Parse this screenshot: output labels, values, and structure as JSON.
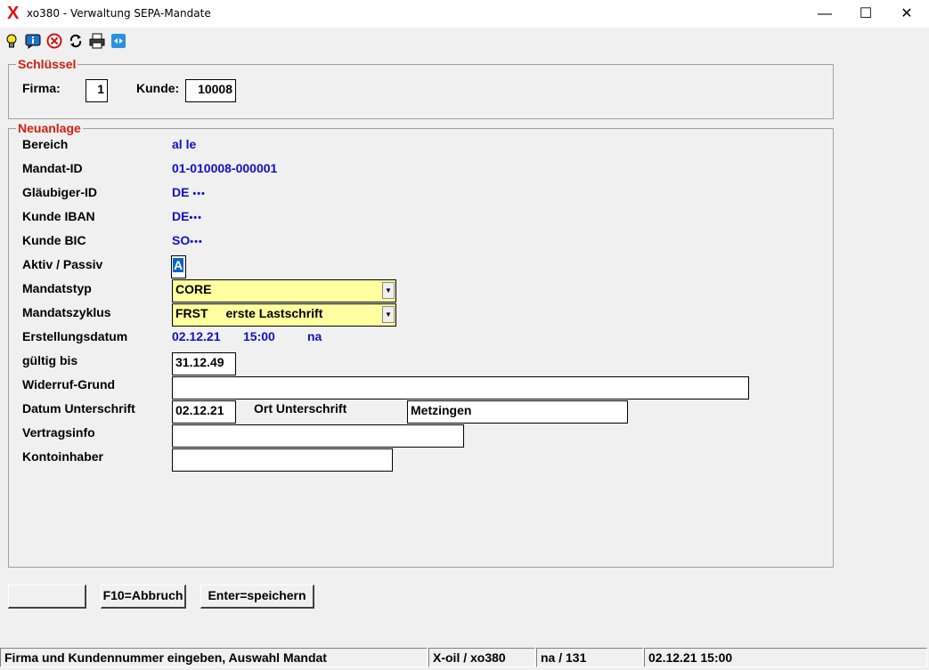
{
  "window": {
    "title": "xo380 - Verwaltung SEPA-Mandate",
    "minimize": "—",
    "maximize": "☐",
    "close": "✕"
  },
  "toolbar": {
    "icons": [
      "lightbulb-icon",
      "info-icon",
      "cancel-icon",
      "refresh-icon",
      "printer-icon",
      "remote-icon"
    ]
  },
  "schluessel": {
    "legend": "Schlüssel",
    "firma_label": "Firma:",
    "firma_value": "1",
    "kunde_label": "Kunde:",
    "kunde_value": "10008"
  },
  "neuanlage": {
    "legend": "Neuanlage",
    "bereich_label": "Bereich",
    "bereich_value": "al le",
    "mandat_id_label": "Mandat-ID",
    "mandat_id_value": "01-010008-000001",
    "glaeubiger_label": "Gläubiger-ID",
    "glaeubiger_value": "DE",
    "iban_label": "Kunde IBAN",
    "iban_value": "DE",
    "bic_label": "Kunde BIC",
    "bic_value": "SO",
    "masked": "•••",
    "aktiv_label": "Aktiv / Passiv",
    "aktiv_value": "A",
    "mandatstyp_label": "Mandatstyp",
    "mandatstyp_value": "CORE",
    "zyklus_label": "Mandatszyklus",
    "zyklus_code": "FRST",
    "zyklus_text": "erste Lastschrift",
    "erstellung_label": "Erstellungsdatum",
    "erstellung_date": "02.12.21",
    "erstellung_time": "15:00",
    "erstellung_user": "na",
    "gueltig_label": "gültig bis",
    "gueltig_value": "31.12.49",
    "widerruf_label": "Widerruf-Grund",
    "widerruf_value": "",
    "datum_unterschrift_label": "Datum Unterschrift",
    "datum_unterschrift_value": "02.12.21",
    "ort_unterschrift_label": "Ort Unterschrift",
    "ort_unterschrift_value": "Metzingen",
    "vertragsinfo_label": "Vertragsinfo",
    "vertragsinfo_value": "",
    "kontoinhaber_label": "Kontoinhaber",
    "kontoinhaber_value": ""
  },
  "buttons": {
    "blank": "",
    "abbruch": "F10=Abbruch",
    "speichern": "Enter=speichern"
  },
  "statusbar": {
    "message": "Firma und Kundennummer eingeben, Auswahl Mandat",
    "app": "X-oil / xo380",
    "user": "na / 131",
    "datetime": "02.12.21 15:00"
  },
  "colors": {
    "legend": "#d02010",
    "value_blue": "#1010c8",
    "dropdown_bg": "#ffffa0"
  }
}
